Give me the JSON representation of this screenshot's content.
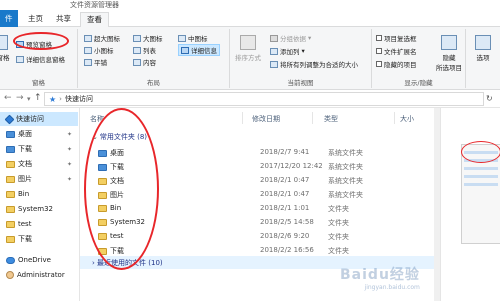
{
  "window": {
    "title": "文件资源管理器"
  },
  "tabs": {
    "file": "件",
    "home": "主页",
    "share": "共享",
    "view": "查看"
  },
  "ribbon": {
    "pane": {
      "preview": "预览窗格",
      "details": "详细信息窗格",
      "nav_partial": "窗格",
      "label": "窗格"
    },
    "layout": {
      "xlarge": "超大图标",
      "large": "大图标",
      "medium": "中图标",
      "small": "小图标",
      "list": "列表",
      "details": "详细信息",
      "tiles": "平铺",
      "content": "内容",
      "label": "布局"
    },
    "view": {
      "sort": "排序方式",
      "group_by": "分组依据",
      "add_column": "添加列",
      "size_all_columns": "将所有列调整为合适的大小",
      "label": "当前视图"
    },
    "show_hide": {
      "item_checkbox": "项目复选框",
      "extensions": "文件扩展名",
      "hidden_items": "隐藏的项目",
      "hide_selected_line1": "隐藏",
      "hide_selected_line2": "所选项目",
      "label": "显示/隐藏"
    },
    "options": "选项"
  },
  "address": {
    "path": "快速访问"
  },
  "sidebar": {
    "items": [
      {
        "label": "快速访问",
        "icon": "star",
        "selected": true
      },
      {
        "label": "桌面",
        "icon": "blue",
        "pinned": true
      },
      {
        "label": "下载",
        "icon": "blue",
        "pinned": true
      },
      {
        "label": "文档",
        "icon": "folder",
        "pinned": true
      },
      {
        "label": "图片",
        "icon": "folder",
        "pinned": true
      },
      {
        "label": "Bin",
        "icon": "folder"
      },
      {
        "label": "System32",
        "icon": "folder"
      },
      {
        "label": "test",
        "icon": "folder"
      },
      {
        "label": "下载",
        "icon": "folder"
      },
      {
        "label": "OneDrive",
        "icon": "cloud"
      },
      {
        "label": "Administrator",
        "icon": "user"
      }
    ]
  },
  "columns": {
    "name": "名称",
    "date": "修改日期",
    "type": "类型",
    "size": "大小"
  },
  "frequent": {
    "title": "常用文件夹 (8)",
    "rows": [
      {
        "name": "桌面",
        "date": "2018/2/7 9:41",
        "type": "系统文件夹",
        "icon": "blue"
      },
      {
        "name": "下载",
        "date": "2017/12/20 12:42",
        "type": "系统文件夹",
        "icon": "blue"
      },
      {
        "name": "文档",
        "date": "2018/2/1 0:47",
        "type": "系统文件夹",
        "icon": "folder"
      },
      {
        "name": "图片",
        "date": "2018/2/1 0:47",
        "type": "系统文件夹",
        "icon": "folder"
      },
      {
        "name": "Bin",
        "date": "2018/2/1 1:01",
        "type": "文件夹",
        "icon": "folder"
      },
      {
        "name": "System32",
        "date": "2018/2/5 14:58",
        "type": "文件夹",
        "icon": "folder"
      },
      {
        "name": "test",
        "date": "2018/2/6 9:20",
        "type": "文件夹",
        "icon": "folder"
      },
      {
        "name": "下载",
        "date": "2018/2/2 16:56",
        "type": "文件夹",
        "icon": "folder"
      }
    ]
  },
  "recent": {
    "title": "最近使用的文件 (10)"
  },
  "watermark": {
    "main": "Baidu经验",
    "sub": "jingyan.baidu.com"
  },
  "colors": {
    "file_tab": "#1979ca",
    "selection": "#cce8ff",
    "annotation": "#e8262a"
  }
}
